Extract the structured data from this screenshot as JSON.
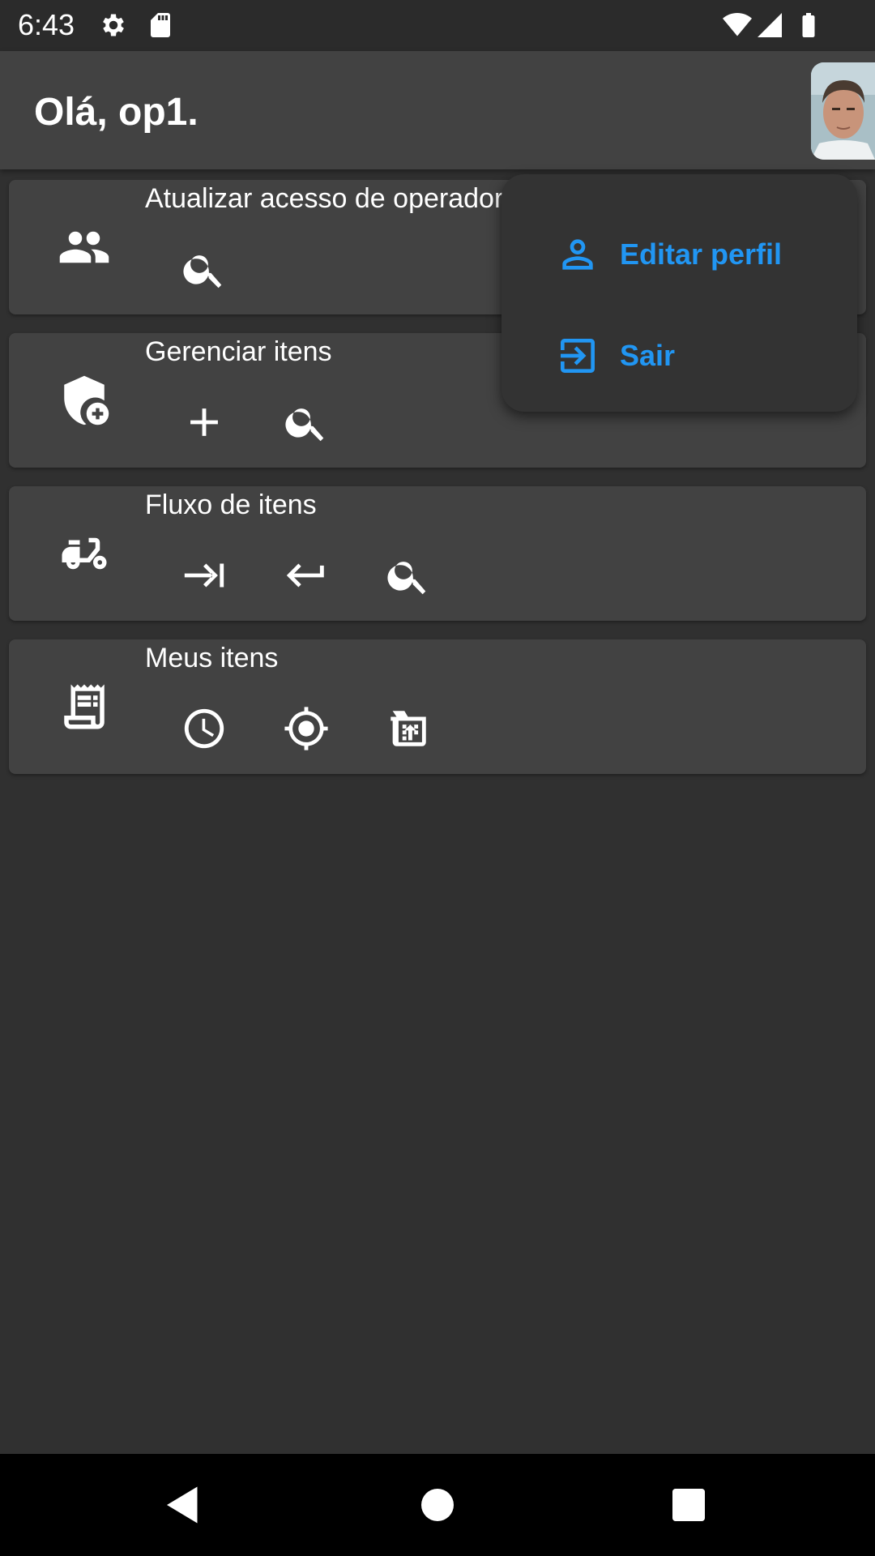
{
  "status_bar": {
    "time": "6:43",
    "icons_left": [
      "settings-icon",
      "sd-card-icon"
    ],
    "icons_right": [
      "wifi-icon",
      "signal-icon",
      "battery-icon"
    ]
  },
  "app_bar": {
    "greeting": "Olá, op1.",
    "avatar": "profile-photo"
  },
  "cards": [
    {
      "title": "Atualizar acesso de operadores",
      "icon": "group-icon",
      "actions": [
        "search-icon"
      ]
    },
    {
      "title": "Gerenciar itens",
      "icon": "shield-add-icon",
      "actions": [
        "add-icon",
        "search-icon"
      ]
    },
    {
      "title": "Fluxo de itens",
      "icon": "moped-icon",
      "actions": [
        "arrow-to-end-icon",
        "return-icon",
        "search-icon"
      ]
    },
    {
      "title": "Meus itens",
      "icon": "receipt-icon",
      "actions": [
        "history-icon",
        "gps-target-icon",
        "unarchive-icon"
      ]
    }
  ],
  "menu": {
    "items": [
      {
        "label": "Editar perfil",
        "icon": "person-outline-icon"
      },
      {
        "label": "Sair",
        "icon": "logout-icon"
      }
    ],
    "accent_color": "#2196f3"
  },
  "nav_bar": {
    "buttons": [
      "back-icon",
      "home-icon",
      "recents-icon"
    ]
  },
  "colors": {
    "background": "#303030",
    "surface": "#424242",
    "accent": "#2196f3"
  }
}
